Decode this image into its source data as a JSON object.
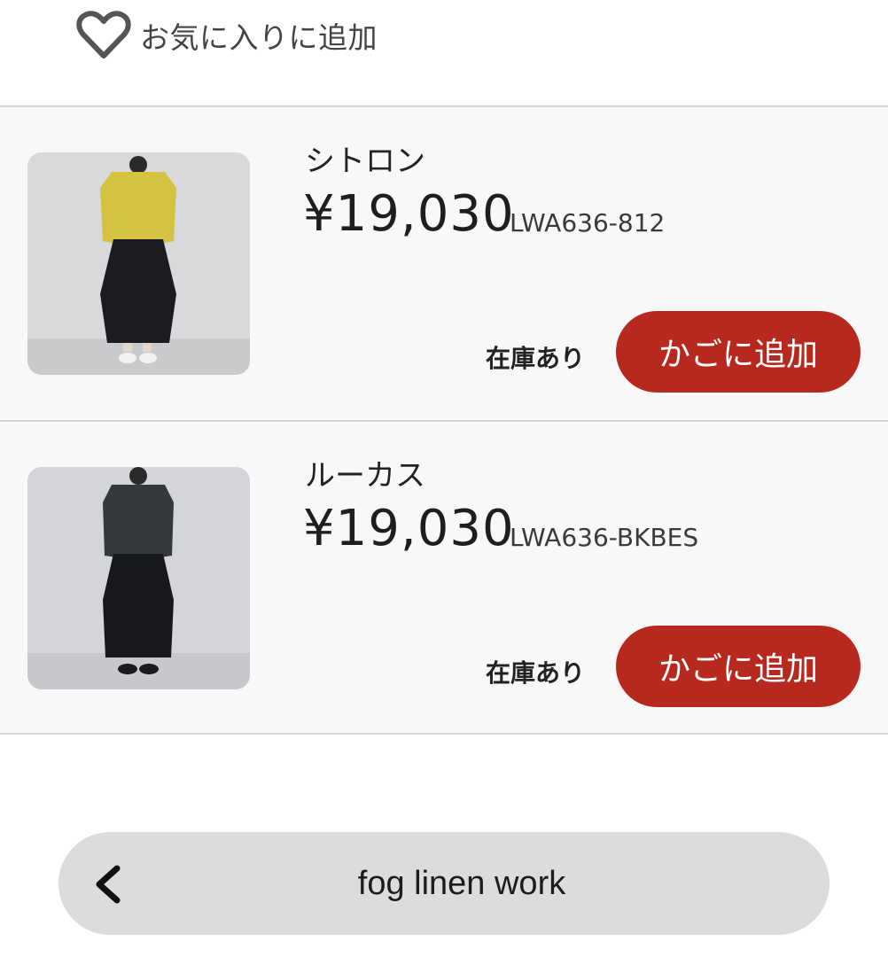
{
  "favorite": {
    "icon": "heart-outline-icon",
    "label": "お気に入りに追加"
  },
  "products": [
    {
      "name": "シトロン",
      "price": "¥19,030",
      "code": "LWA636-812",
      "stock": "在庫あり",
      "cart_label": "かごに追加",
      "thumbnail": "product-photo-yellow-shirt"
    },
    {
      "name": "ルーカス",
      "price": "¥19,030",
      "code": "LWA636-BKBES",
      "stock": "在庫あり",
      "cart_label": "かごに追加",
      "thumbnail": "product-photo-charcoal-shirt"
    }
  ],
  "footer": {
    "back_icon": "chevron-left-icon",
    "label": "fog linen work"
  },
  "colors": {
    "cart_button": "#b7291e",
    "row_background": "#f8f8f8",
    "back_bar": "#dcdcdc"
  }
}
